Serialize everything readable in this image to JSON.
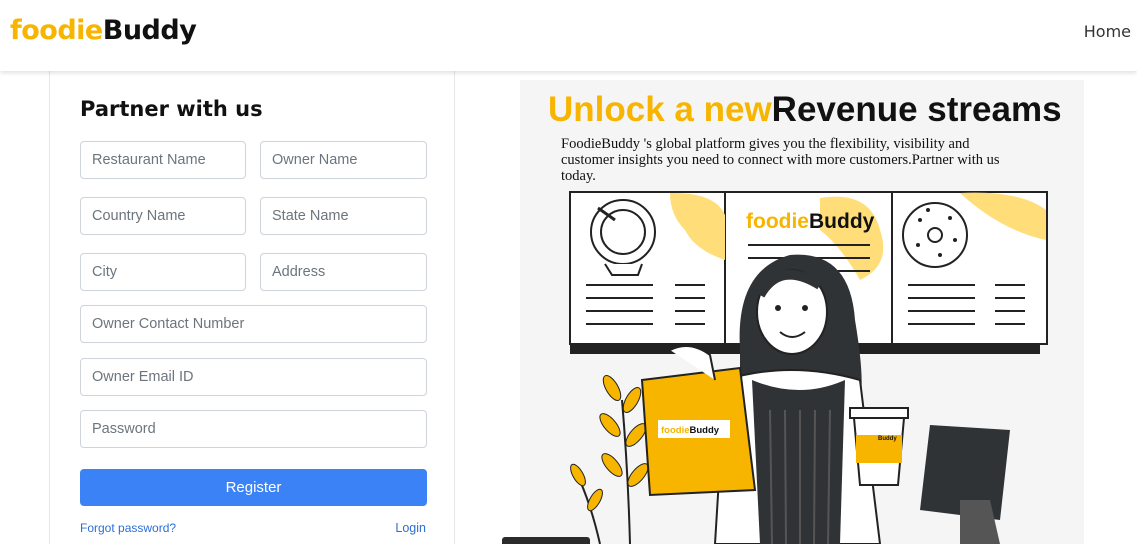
{
  "navbar": {
    "logo_part1": "foodie",
    "logo_part2": "Buddy",
    "home_link": "Home"
  },
  "form": {
    "title": "Partner with us",
    "restaurant_name_placeholder": "Restaurant Name",
    "owner_name_placeholder": "Owner Name",
    "country_name_placeholder": "Country Name",
    "state_name_placeholder": "State Name",
    "city_placeholder": "City",
    "address_placeholder": "Address",
    "owner_contact_placeholder": "Owner Contact Number",
    "owner_email_placeholder": "Owner Email ID",
    "password_placeholder": "Password",
    "register_label": "Register",
    "forgot_password_label": "Forgot password?",
    "login_label": "Login"
  },
  "promo": {
    "headline_highlight": "Unlock a new",
    "headline_rest": "Revenue streams",
    "description": "FoodieBuddy 's global platform gives you the flexibility, visibility and customer insights you need to connect with more customers.Partner with us today.",
    "board_logo_part1": "foodie",
    "board_logo_part2": "Buddy",
    "bag_logo": "foodieBuddy",
    "cup_logo": "foodieBuddy"
  },
  "colors": {
    "brand_yellow": "#f7b500",
    "button_blue": "#3b82f6",
    "link_blue": "#2b6fd6"
  }
}
